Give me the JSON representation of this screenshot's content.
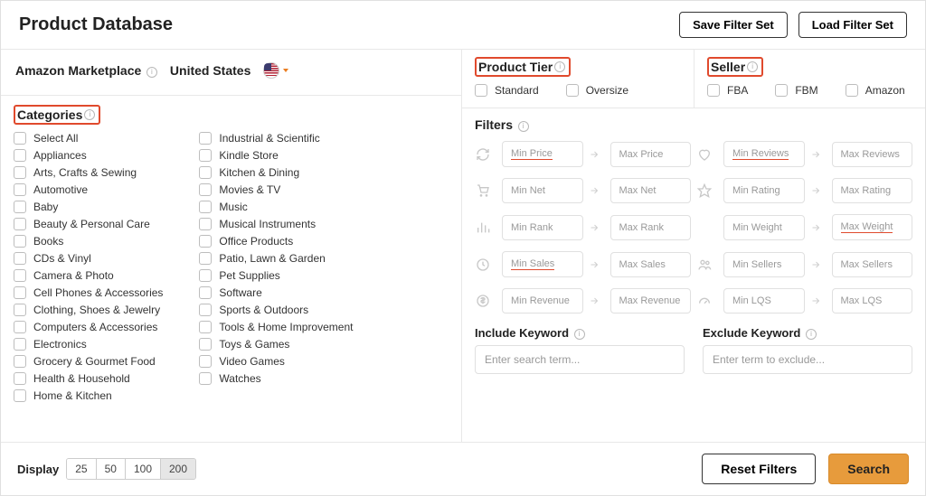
{
  "header": {
    "title": "Product Database",
    "save_label": "Save Filter Set",
    "load_label": "Load Filter Set"
  },
  "marketplace": {
    "label": "Amazon Marketplace",
    "value": "United States"
  },
  "categories": {
    "heading": "Categories",
    "col1": [
      "Select All",
      "Appliances",
      "Arts, Crafts & Sewing",
      "Automotive",
      "Baby",
      "Beauty & Personal Care",
      "Books",
      "CDs & Vinyl",
      "Camera & Photo",
      "Cell Phones & Accessories",
      "Clothing, Shoes & Jewelry",
      "Computers & Accessories",
      "Electronics",
      "Grocery & Gourmet Food",
      "Health & Household",
      "Home & Kitchen"
    ],
    "col2": [
      "Industrial & Scientific",
      "Kindle Store",
      "Kitchen & Dining",
      "Movies & TV",
      "Music",
      "Musical Instruments",
      "Office Products",
      "Patio, Lawn & Garden",
      "Pet Supplies",
      "Software",
      "Sports & Outdoors",
      "Tools & Home Improvement",
      "Toys & Games",
      "Video Games",
      "Watches"
    ]
  },
  "product_tier": {
    "heading": "Product Tier",
    "options": [
      "Standard",
      "Oversize"
    ]
  },
  "seller": {
    "heading": "Seller",
    "options": [
      "FBA",
      "FBM",
      "Amazon"
    ]
  },
  "filters": {
    "heading": "Filters",
    "rows": [
      {
        "iconA": "refresh",
        "minA": "Min Price",
        "ulA": true,
        "maxA": "Max Price",
        "iconB": "heart",
        "minB": "Min Reviews",
        "ulB": true,
        "maxB": "Max Reviews",
        "ulMaxB": false
      },
      {
        "iconA": "cart",
        "minA": "Min Net",
        "ulA": false,
        "maxA": "Max Net",
        "iconB": "star",
        "minB": "Min Rating",
        "ulB": false,
        "maxB": "Max Rating",
        "ulMaxB": false
      },
      {
        "iconA": "bars",
        "minA": "Min Rank",
        "ulA": false,
        "maxA": "Max Rank",
        "iconB": "",
        "minB": "Min Weight",
        "ulB": false,
        "maxB": "Max Weight",
        "ulMaxB": true
      },
      {
        "iconA": "clock",
        "minA": "Min Sales",
        "ulA": true,
        "maxA": "Max Sales",
        "iconB": "users",
        "minB": "Min Sellers",
        "ulB": false,
        "maxB": "Max Sellers",
        "ulMaxB": false
      },
      {
        "iconA": "dollar",
        "minA": "Min Revenue",
        "ulA": false,
        "maxA": "Max Revenue",
        "iconB": "gauge",
        "minB": "Min LQS",
        "ulB": false,
        "maxB": "Max LQS",
        "ulMaxB": false
      }
    ]
  },
  "include_keyword": {
    "label": "Include Keyword",
    "placeholder": "Enter search term..."
  },
  "exclude_keyword": {
    "label": "Exclude Keyword",
    "placeholder": "Enter term to exclude..."
  },
  "footer": {
    "display_label": "Display",
    "sizes": [
      "25",
      "50",
      "100",
      "200"
    ],
    "active_size": "200",
    "reset_label": "Reset Filters",
    "search_label": "Search"
  }
}
